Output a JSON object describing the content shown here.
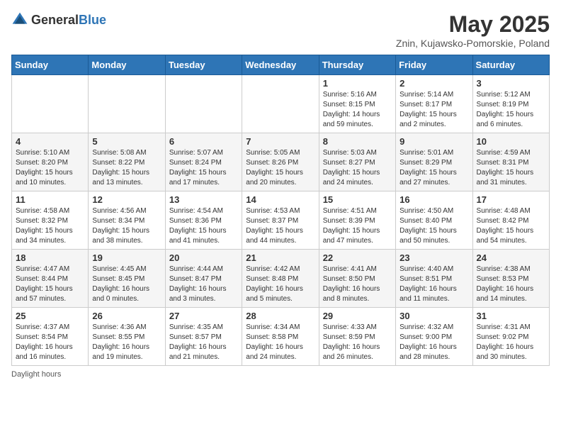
{
  "header": {
    "logo_general": "General",
    "logo_blue": "Blue",
    "main_title": "May 2025",
    "subtitle": "Znin, Kujawsko-Pomorskie, Poland"
  },
  "days_of_week": [
    "Sunday",
    "Monday",
    "Tuesday",
    "Wednesday",
    "Thursday",
    "Friday",
    "Saturday"
  ],
  "weeks": [
    [
      {
        "day": "",
        "info": ""
      },
      {
        "day": "",
        "info": ""
      },
      {
        "day": "",
        "info": ""
      },
      {
        "day": "",
        "info": ""
      },
      {
        "day": "1",
        "info": "Sunrise: 5:16 AM\nSunset: 8:15 PM\nDaylight: 14 hours and 59 minutes."
      },
      {
        "day": "2",
        "info": "Sunrise: 5:14 AM\nSunset: 8:17 PM\nDaylight: 15 hours and 2 minutes."
      },
      {
        "day": "3",
        "info": "Sunrise: 5:12 AM\nSunset: 8:19 PM\nDaylight: 15 hours and 6 minutes."
      }
    ],
    [
      {
        "day": "4",
        "info": "Sunrise: 5:10 AM\nSunset: 8:20 PM\nDaylight: 15 hours and 10 minutes."
      },
      {
        "day": "5",
        "info": "Sunrise: 5:08 AM\nSunset: 8:22 PM\nDaylight: 15 hours and 13 minutes."
      },
      {
        "day": "6",
        "info": "Sunrise: 5:07 AM\nSunset: 8:24 PM\nDaylight: 15 hours and 17 minutes."
      },
      {
        "day": "7",
        "info": "Sunrise: 5:05 AM\nSunset: 8:26 PM\nDaylight: 15 hours and 20 minutes."
      },
      {
        "day": "8",
        "info": "Sunrise: 5:03 AM\nSunset: 8:27 PM\nDaylight: 15 hours and 24 minutes."
      },
      {
        "day": "9",
        "info": "Sunrise: 5:01 AM\nSunset: 8:29 PM\nDaylight: 15 hours and 27 minutes."
      },
      {
        "day": "10",
        "info": "Sunrise: 4:59 AM\nSunset: 8:31 PM\nDaylight: 15 hours and 31 minutes."
      }
    ],
    [
      {
        "day": "11",
        "info": "Sunrise: 4:58 AM\nSunset: 8:32 PM\nDaylight: 15 hours and 34 minutes."
      },
      {
        "day": "12",
        "info": "Sunrise: 4:56 AM\nSunset: 8:34 PM\nDaylight: 15 hours and 38 minutes."
      },
      {
        "day": "13",
        "info": "Sunrise: 4:54 AM\nSunset: 8:36 PM\nDaylight: 15 hours and 41 minutes."
      },
      {
        "day": "14",
        "info": "Sunrise: 4:53 AM\nSunset: 8:37 PM\nDaylight: 15 hours and 44 minutes."
      },
      {
        "day": "15",
        "info": "Sunrise: 4:51 AM\nSunset: 8:39 PM\nDaylight: 15 hours and 47 minutes."
      },
      {
        "day": "16",
        "info": "Sunrise: 4:50 AM\nSunset: 8:40 PM\nDaylight: 15 hours and 50 minutes."
      },
      {
        "day": "17",
        "info": "Sunrise: 4:48 AM\nSunset: 8:42 PM\nDaylight: 15 hours and 54 minutes."
      }
    ],
    [
      {
        "day": "18",
        "info": "Sunrise: 4:47 AM\nSunset: 8:44 PM\nDaylight: 15 hours and 57 minutes."
      },
      {
        "day": "19",
        "info": "Sunrise: 4:45 AM\nSunset: 8:45 PM\nDaylight: 16 hours and 0 minutes."
      },
      {
        "day": "20",
        "info": "Sunrise: 4:44 AM\nSunset: 8:47 PM\nDaylight: 16 hours and 3 minutes."
      },
      {
        "day": "21",
        "info": "Sunrise: 4:42 AM\nSunset: 8:48 PM\nDaylight: 16 hours and 5 minutes."
      },
      {
        "day": "22",
        "info": "Sunrise: 4:41 AM\nSunset: 8:50 PM\nDaylight: 16 hours and 8 minutes."
      },
      {
        "day": "23",
        "info": "Sunrise: 4:40 AM\nSunset: 8:51 PM\nDaylight: 16 hours and 11 minutes."
      },
      {
        "day": "24",
        "info": "Sunrise: 4:38 AM\nSunset: 8:53 PM\nDaylight: 16 hours and 14 minutes."
      }
    ],
    [
      {
        "day": "25",
        "info": "Sunrise: 4:37 AM\nSunset: 8:54 PM\nDaylight: 16 hours and 16 minutes."
      },
      {
        "day": "26",
        "info": "Sunrise: 4:36 AM\nSunset: 8:55 PM\nDaylight: 16 hours and 19 minutes."
      },
      {
        "day": "27",
        "info": "Sunrise: 4:35 AM\nSunset: 8:57 PM\nDaylight: 16 hours and 21 minutes."
      },
      {
        "day": "28",
        "info": "Sunrise: 4:34 AM\nSunset: 8:58 PM\nDaylight: 16 hours and 24 minutes."
      },
      {
        "day": "29",
        "info": "Sunrise: 4:33 AM\nSunset: 8:59 PM\nDaylight: 16 hours and 26 minutes."
      },
      {
        "day": "30",
        "info": "Sunrise: 4:32 AM\nSunset: 9:00 PM\nDaylight: 16 hours and 28 minutes."
      },
      {
        "day": "31",
        "info": "Sunrise: 4:31 AM\nSunset: 9:02 PM\nDaylight: 16 hours and 30 minutes."
      }
    ]
  ],
  "footer": {
    "daylight_label": "Daylight hours"
  }
}
